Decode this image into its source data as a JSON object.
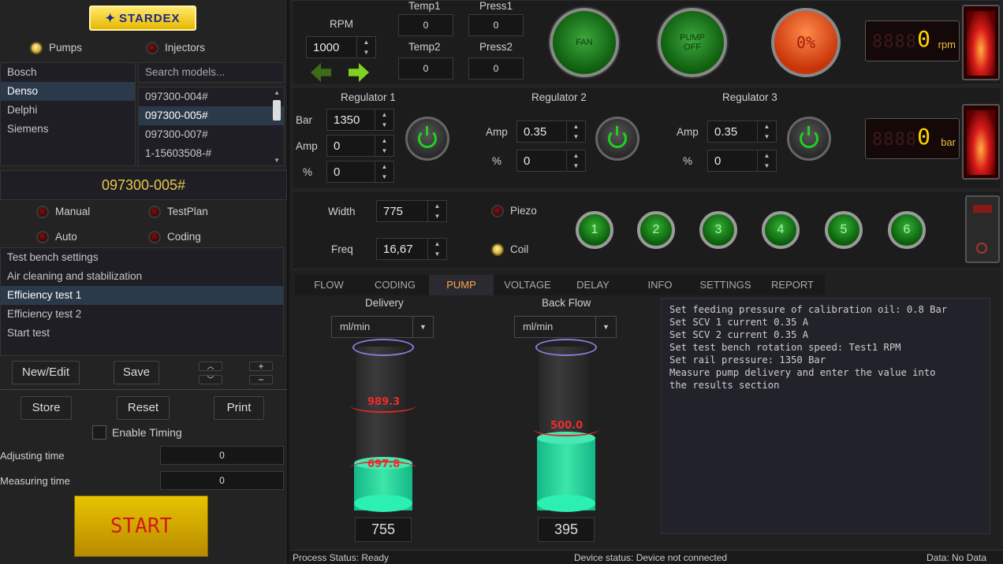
{
  "logo": "STARDEX",
  "mode": {
    "pumps": "Pumps",
    "injectors": "Injectors"
  },
  "brands": [
    "Bosch",
    "Denso",
    "Delphi",
    "Siemens"
  ],
  "search_placeholder": "Search models...",
  "models": [
    "097300-004#",
    "097300-005#",
    "097300-007#",
    "1-15603508-#"
  ],
  "selected_model": "097300-005#",
  "test_modes": {
    "manual": "Manual",
    "testplan": "TestPlan",
    "auto": "Auto",
    "coding": "Coding"
  },
  "tests": [
    "Test bench settings",
    "Air cleaning and stabilization",
    "Efficiency test 1",
    "Efficiency test 2",
    "Start test"
  ],
  "buttons": {
    "new_edit": "New/Edit",
    "save": "Save",
    "store": "Store",
    "reset": "Reset",
    "print": "Print",
    "start": "START",
    "plus": "+",
    "minus": "−"
  },
  "timing": {
    "enable": "Enable Timing",
    "adjusting_label": "Adjusting time",
    "adjusting_value": "0",
    "measuring_label": "Measuring time",
    "measuring_value": "0"
  },
  "top": {
    "rpm_label": "RPM",
    "rpm_value": "1000",
    "temp1_label": "Temp1",
    "temp1_value": "0",
    "press1_label": "Press1",
    "press1_value": "0",
    "temp2_label": "Temp2",
    "temp2_value": "0",
    "press2_label": "Press2",
    "press2_value": "0",
    "fan": "FAN",
    "pump_off_line1": "PUMP",
    "pump_off_line2": "OFF",
    "percent_btn": "0%",
    "rpm_display": "0",
    "rpm_unit": "rpm",
    "bar_display": "0",
    "bar_unit": "bar",
    "display_ghost": "8888"
  },
  "regulators": {
    "r1": {
      "title": "Regulator 1",
      "bar_label": "Bar",
      "bar": "1350",
      "amp_label": "Amp",
      "amp": "0",
      "pct_label": "%",
      "pct": "0"
    },
    "r2": {
      "title": "Regulator 2",
      "amp_label": "Amp",
      "amp": "0.35",
      "pct_label": "%",
      "pct": "0"
    },
    "r3": {
      "title": "Regulator 3",
      "amp_label": "Amp",
      "amp": "0.35",
      "pct_label": "%",
      "pct": "0"
    }
  },
  "injection": {
    "width_label": "Width",
    "width": "775",
    "freq_label": "Freq",
    "freq": "16,67",
    "piezo": "Piezo",
    "coil": "Coil",
    "channels": [
      "1",
      "2",
      "3",
      "4",
      "5",
      "6"
    ]
  },
  "tabs": [
    "FLOW",
    "CODING",
    "PUMP",
    "VOLTAGE",
    "DELAY",
    "INFO",
    "SETTINGS",
    "REPORT"
  ],
  "selected_tab": "PUMP",
  "delivery": {
    "title": "Delivery",
    "unit": "ml/min",
    "upper": "989.3",
    "lower": "697.8",
    "value": "755",
    "fill_fraction": 0.3
  },
  "backflow": {
    "title": "Back Flow",
    "unit": "ml/min",
    "upper": "500.0",
    "value": "395",
    "fill_fraction": 0.46
  },
  "instructions": [
    "Set feeding pressure of calibration oil: 0.8 Bar",
    "Set SCV 1 current 0.35 A",
    "Set SCV 2 current 0.35 A",
    "Set test bench rotation speed: Test1 RPM",
    "Set rail pressure: 1350 Bar",
    "Measure pump delivery and enter the value into",
    "the results section"
  ],
  "status": {
    "process": "Process Status: Ready",
    "device": "Device status: Device not connected",
    "data": "Data: No Data"
  }
}
